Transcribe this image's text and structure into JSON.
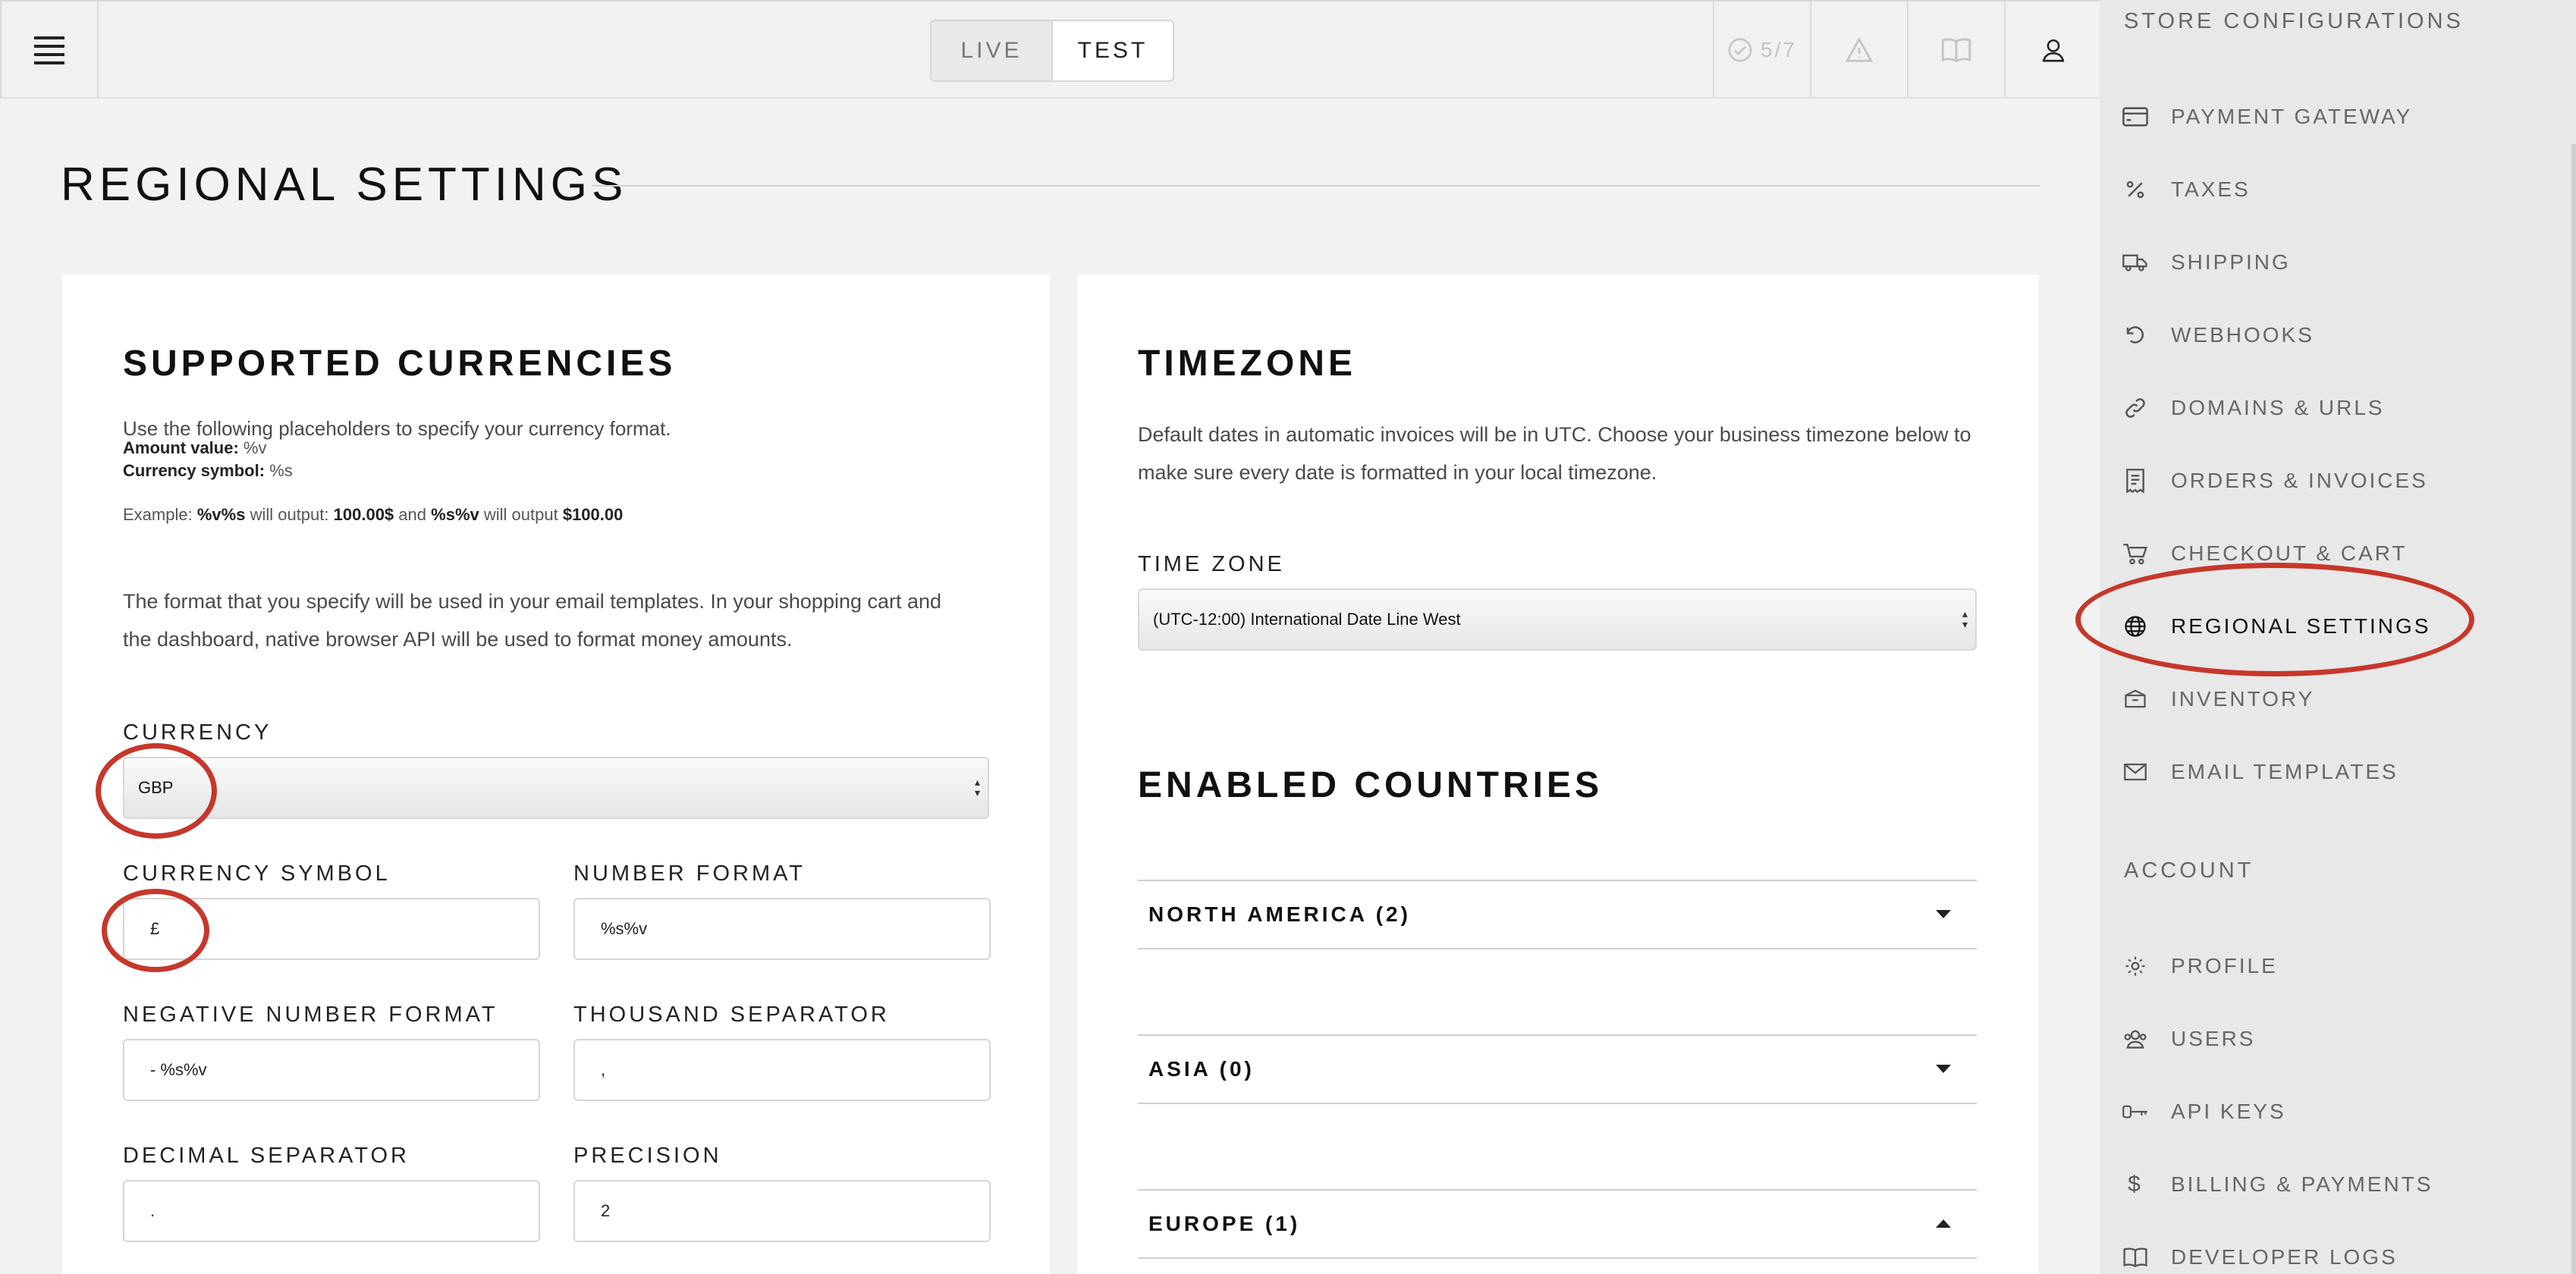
{
  "topbar": {
    "mode_live": "LIVE",
    "mode_test": "TEST",
    "progress": "5/7"
  },
  "page": {
    "title": "REGIONAL SETTINGS"
  },
  "currencies": {
    "title": "SUPPORTED CURRENCIES",
    "intro": "Use the following placeholders to specify your currency format.",
    "amount_label": "Amount value:",
    "amount_value": "%v",
    "symbol_label": "Currency symbol:",
    "symbol_value": "%s",
    "example_prefix": "Example:",
    "example_fmt1": "%v%s",
    "example_mid1": "will output:",
    "example_out1": "100.00$",
    "example_and": "and",
    "example_fmt2": "%s%v",
    "example_mid2": "will output",
    "example_out2": "$100.00",
    "format_note": "The format that you specify will be used in your email templates. In your shopping cart and the dashboard, native browser API will be used to format money amounts.",
    "currency_label": "CURRENCY",
    "currency_value": "GBP",
    "symbol_field_label": "CURRENCY SYMBOL",
    "symbol_field_value": "£",
    "number_format_label": "NUMBER FORMAT",
    "number_format_value": "%s%v",
    "negative_label": "NEGATIVE NUMBER FORMAT",
    "negative_value": "- %s%v",
    "thousand_label": "THOUSAND SEPARATOR",
    "thousand_value": ",",
    "decimal_label": "DECIMAL SEPARATOR",
    "decimal_value": ".",
    "precision_label": "PRECISION",
    "precision_value": "2"
  },
  "timezone": {
    "title": "TIMEZONE",
    "description": "Default dates in automatic invoices will be in UTC. Choose your business timezone below to make sure every date is formatted in your local timezone.",
    "label": "TIME ZONE",
    "value": "(UTC-12:00) International Date Line West"
  },
  "countries": {
    "title": "ENABLED COUNTRIES",
    "groups": [
      {
        "label": "NORTH AMERICA (2)",
        "state": "collapsed"
      },
      {
        "label": "ASIA (0)",
        "state": "collapsed"
      },
      {
        "label": "EUROPE (1)",
        "state": "expanded"
      }
    ]
  },
  "sidebar": {
    "store_heading": "STORE CONFIGURATIONS",
    "store_items": [
      {
        "label": "PAYMENT GATEWAY",
        "icon": "credit-card-icon"
      },
      {
        "label": "TAXES",
        "icon": "percent-icon"
      },
      {
        "label": "SHIPPING",
        "icon": "truck-icon"
      },
      {
        "label": "WEBHOOKS",
        "icon": "undo-arrow-icon"
      },
      {
        "label": "DOMAINS & URLS",
        "icon": "link-icon"
      },
      {
        "label": "ORDERS & INVOICES",
        "icon": "receipt-icon"
      },
      {
        "label": "CHECKOUT & CART",
        "icon": "cart-icon"
      },
      {
        "label": "REGIONAL SETTINGS",
        "icon": "globe-icon",
        "active": true
      },
      {
        "label": "INVENTORY",
        "icon": "box-icon"
      },
      {
        "label": "EMAIL TEMPLATES",
        "icon": "envelope-icon"
      }
    ],
    "account_heading": "ACCOUNT",
    "account_items": [
      {
        "label": "PROFILE",
        "icon": "gear-icon"
      },
      {
        "label": "USERS",
        "icon": "users-icon"
      },
      {
        "label": "API KEYS",
        "icon": "key-icon"
      },
      {
        "label": "BILLING & PAYMENTS",
        "icon": "dollar-icon"
      },
      {
        "label": "DEVELOPER LOGS",
        "icon": "book-icon"
      }
    ]
  },
  "colors": {
    "annotation": "#c7372b",
    "sidebar_bg": "#e8e8e8",
    "page_bg": "#f2f2f2"
  }
}
